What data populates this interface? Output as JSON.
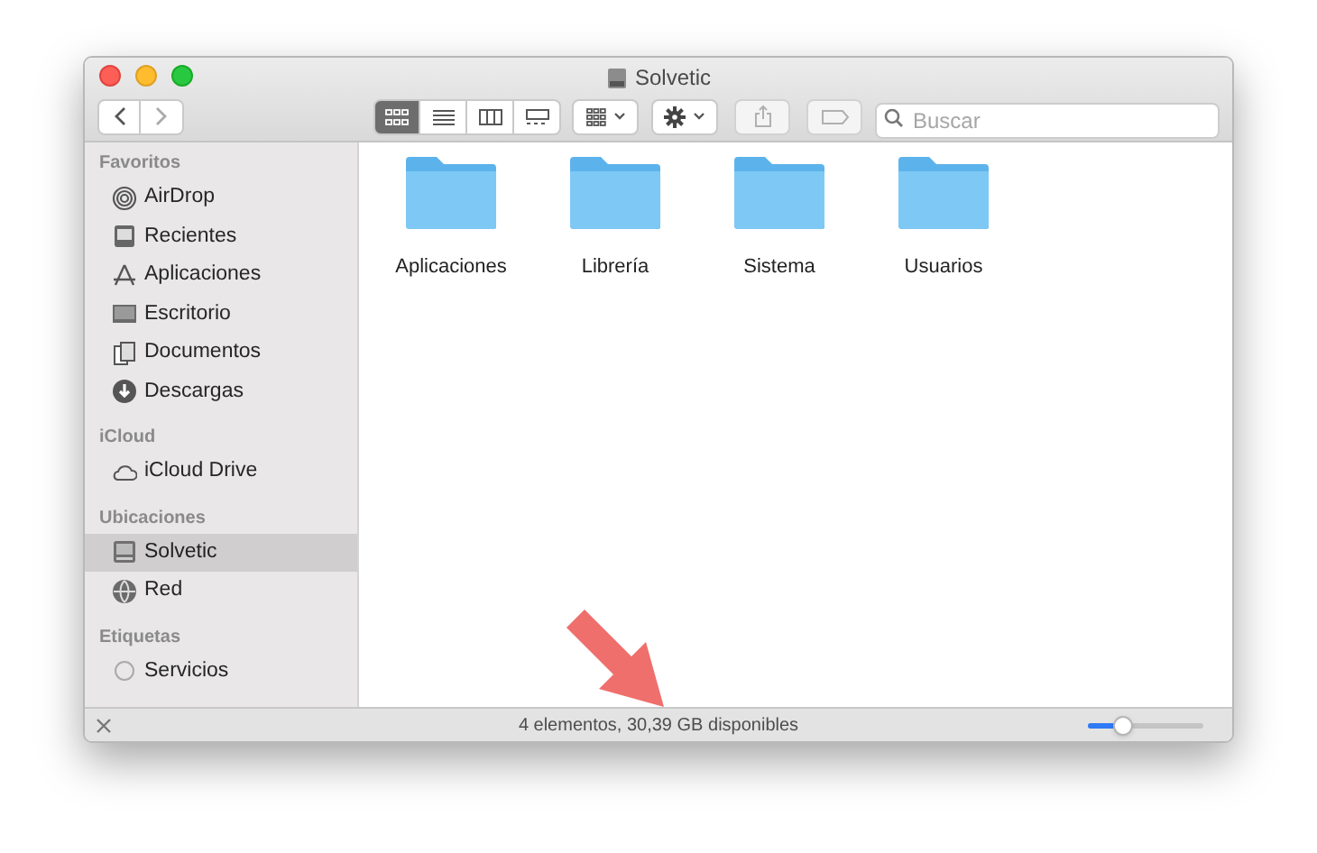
{
  "window": {
    "title": "Solvetic"
  },
  "toolbar": {
    "view_modes": [
      {
        "kind": "icons",
        "selected": true
      },
      {
        "kind": "list",
        "selected": false
      },
      {
        "kind": "columns",
        "selected": false
      },
      {
        "kind": "gallery",
        "selected": false
      }
    ],
    "search": {
      "placeholder": "Buscar"
    }
  },
  "sidebar": {
    "sections": [
      {
        "title": "Favoritos",
        "items": [
          {
            "label": "AirDrop",
            "kind": "airdrop",
            "selected": false
          },
          {
            "label": "Recientes",
            "kind": "recents",
            "selected": false
          },
          {
            "label": "Aplicaciones",
            "kind": "apps",
            "selected": false
          },
          {
            "label": "Escritorio",
            "kind": "desktop",
            "selected": false
          },
          {
            "label": "Documentos",
            "kind": "documents",
            "selected": false
          },
          {
            "label": "Descargas",
            "kind": "downloads",
            "selected": false
          }
        ]
      },
      {
        "title": "iCloud",
        "items": [
          {
            "label": "iCloud Drive",
            "kind": "cloud",
            "selected": false
          }
        ]
      },
      {
        "title": "Ubicaciones",
        "items": [
          {
            "label": "Solvetic",
            "kind": "disk",
            "selected": true
          },
          {
            "label": "Red",
            "kind": "network",
            "selected": false
          }
        ]
      },
      {
        "title": "Etiquetas",
        "items": [
          {
            "label": "Servicios",
            "kind": "tag",
            "selected": false
          }
        ]
      }
    ]
  },
  "folders": [
    {
      "name": "Aplicaciones"
    },
    {
      "name": "Librería"
    },
    {
      "name": "Sistema"
    },
    {
      "name": "Usuarios"
    }
  ],
  "status_bar": {
    "text": "4 elementos, 30,39 GB disponibles",
    "zoom": {
      "level": 0.3
    }
  }
}
